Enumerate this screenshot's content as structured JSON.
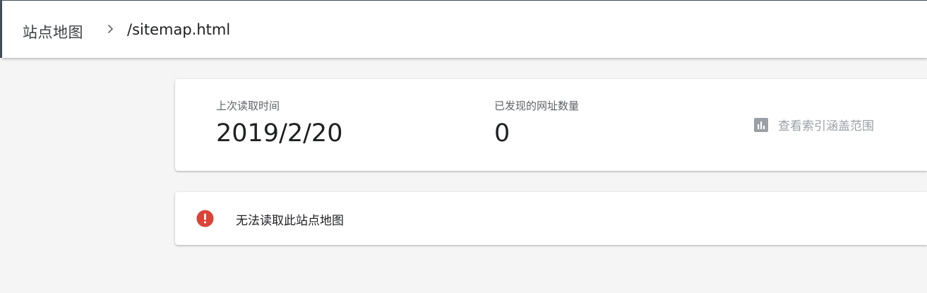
{
  "header": {
    "breadcrumb_root": "站点地图",
    "breadcrumb_current": "/sitemap.html"
  },
  "stats": {
    "last_read_label": "上次读取时间",
    "last_read_value": "2019/2/20",
    "discovered_label": "已发现的网址数量",
    "discovered_value": "0",
    "coverage_link_label": "查看索引涵盖范围"
  },
  "error": {
    "message": "无法读取此站点地图"
  },
  "colors": {
    "error_red": "#db4437",
    "coverage_gray": "#9aa0a6",
    "header_border": "#46535b"
  },
  "icons": {
    "breadcrumb_separator": "chevron-right-icon",
    "coverage": "bar-chart-icon",
    "error": "error-icon"
  }
}
